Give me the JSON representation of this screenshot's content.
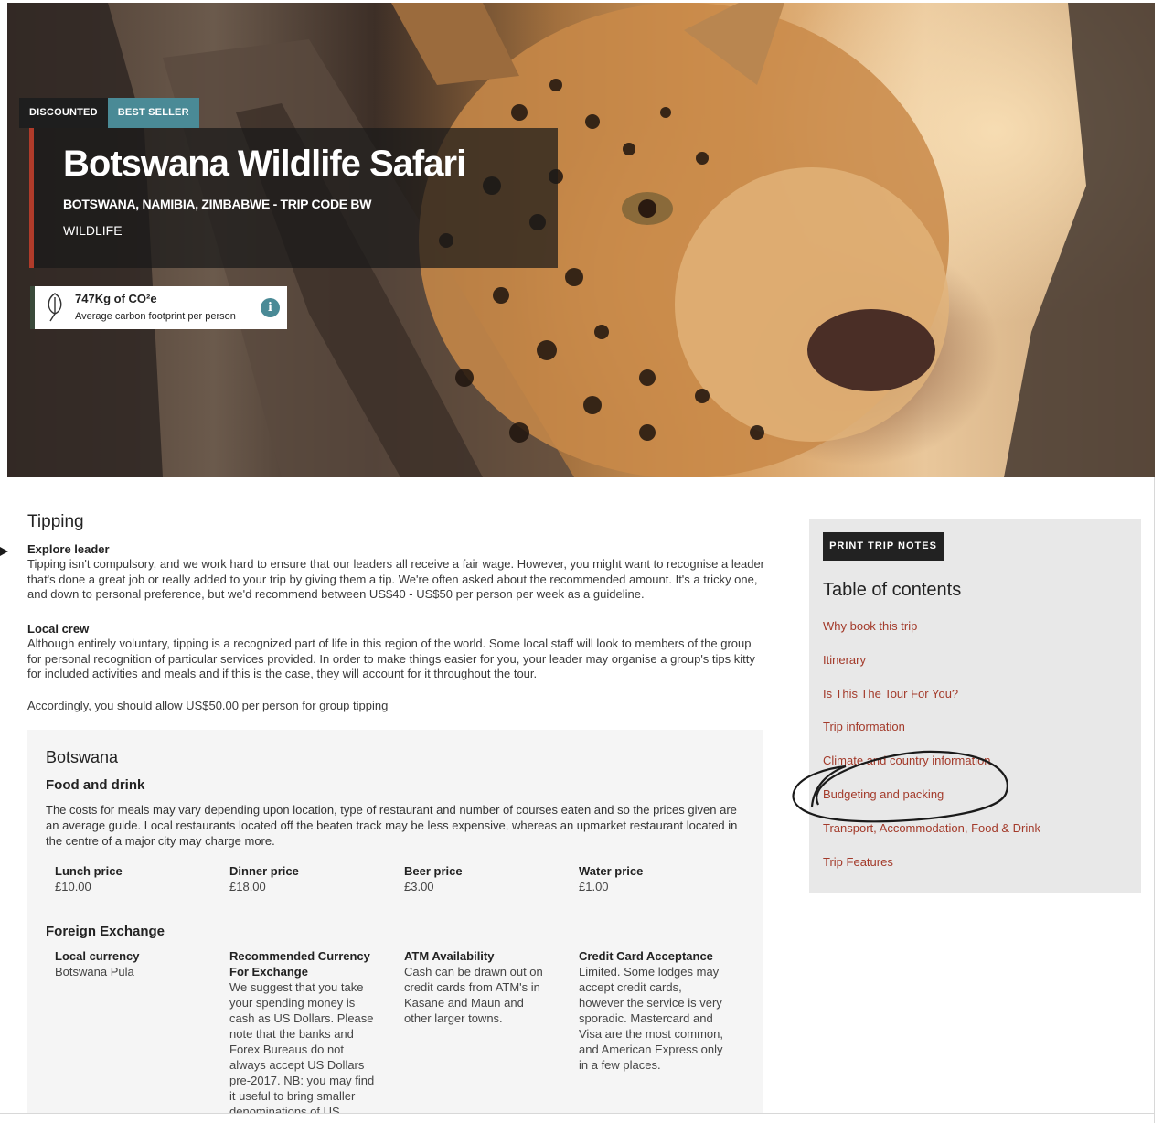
{
  "hero": {
    "tags": [
      "DISCOUNTED",
      "BEST SELLER"
    ],
    "title": "Botswana Wildlife Safari",
    "subtitle": "BOTSWANA, NAMIBIA, ZIMBABWE - TRIP CODE BW",
    "category": "WILDLIFE",
    "carbon": {
      "amount": "747Kg of CO²e",
      "description": "Average carbon footprint per person",
      "icon": "leaf-icon",
      "info_icon": "info-icon"
    }
  },
  "tipping": {
    "heading": "Tipping",
    "leader_heading": "Explore leader",
    "leader_text": "Tipping isn't compulsory, and we work hard to ensure that our leaders all receive a fair wage. However, you might want to recognise a leader that's done a great job or really added to your trip by giving them a tip. We're often asked about the recommended amount. It's a tricky one, and down to personal preference, but we'd recommend between US$40 - US$50 per person per week as a guideline.",
    "crew_heading": "Local crew",
    "crew_text": "Although entirely voluntary, tipping is a recognized part of life in this region of the world. Some local staff will look to members of the group for personal recognition of particular services provided. In order to make things easier for you, your leader may organise a group's tips kitty for included activities and meals and if this is the case, they will account for it throughout the tour.",
    "allowance": "Accordingly, you should allow US$50.00 per person for group tipping"
  },
  "country": {
    "name": "Botswana",
    "food_heading": "Food and drink",
    "food_text": "The costs for meals may vary depending upon location, type of restaurant and number of courses eaten and so the prices given are an average guide. Local restaurants located off the beaten track may be less expensive, whereas an upmarket restaurant located in the centre of a major city may charge more.",
    "prices": [
      {
        "label": "Lunch price",
        "value": "£10.00"
      },
      {
        "label": "Dinner price",
        "value": "£18.00"
      },
      {
        "label": "Beer price",
        "value": "£3.00"
      },
      {
        "label": "Water price",
        "value": "£1.00"
      }
    ],
    "fx_heading": "Foreign Exchange",
    "fx": [
      {
        "label": "Local currency",
        "value": "Botswana Pula"
      },
      {
        "label": "Recommended Currency For Exchange",
        "value": "We suggest that you take your spending money is cash as US Dollars. Please note that the banks and Forex Bureaus do not always accept US Dollars pre-2017. NB: you may find it useful to bring smaller denominations of US"
      },
      {
        "label": "ATM Availability",
        "value": "Cash can be drawn out on credit cards from ATM's in Kasane and Maun and other larger towns."
      },
      {
        "label": "Credit Card Acceptance",
        "value": "Limited. Some lodges may accept credit cards, however the service is very sporadic. Mastercard and Visa are the most common, and American Express only in a few places."
      }
    ]
  },
  "sidebar": {
    "print_label": "PRINT TRIP NOTES",
    "toc_title": "Table of contents",
    "items": [
      "Why book this trip",
      "Itinerary",
      "Is This The Tour For You?",
      "Trip information",
      "Climate and country information",
      "Budgeting and packing",
      "Transport, Accommodation, Food & Drink",
      "Trip Features"
    ]
  },
  "colors": {
    "accent_red": "#a33a2a",
    "tag_teal": "#4a8a96",
    "dark": "#222222"
  }
}
